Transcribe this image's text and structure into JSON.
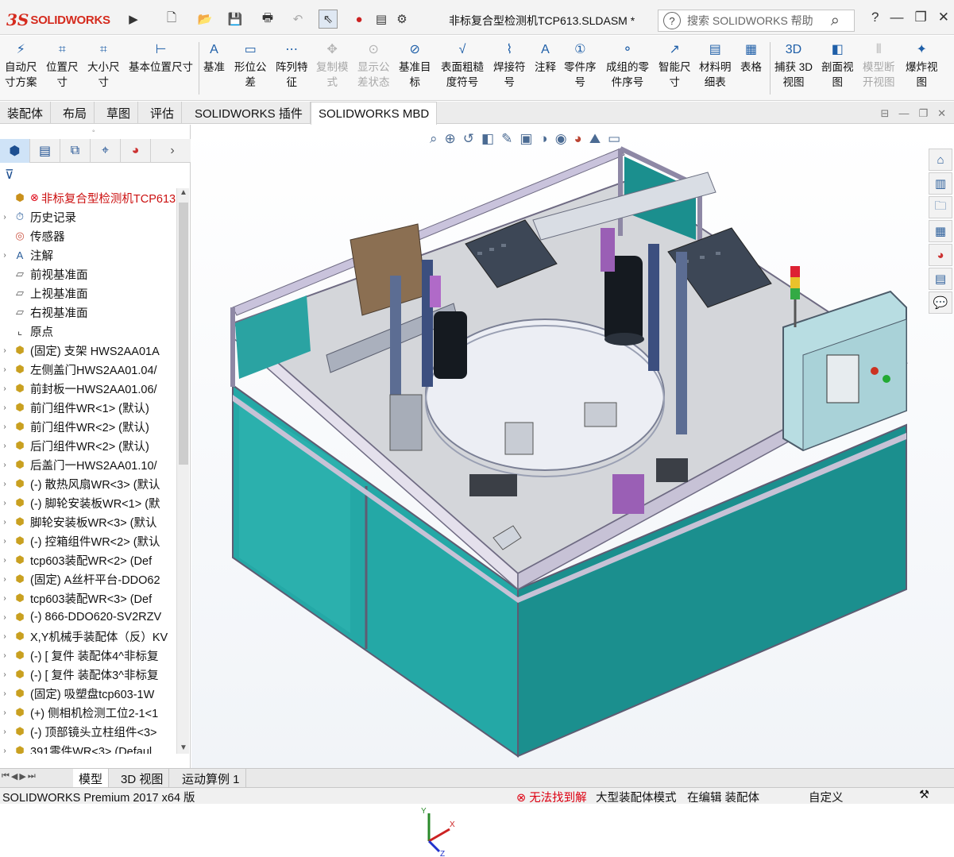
{
  "app": {
    "brand_ds": "3S",
    "brand_name": "SOLIDWORKS",
    "document_title": "非标复合型检测机TCP613.SLDASM *",
    "search_placeholder": "搜索 SOLIDWORKS 帮助",
    "help_label": "?",
    "minimize": "—",
    "close": "✕"
  },
  "commands": [
    {
      "label1": "自动尺",
      "label2": "寸方案",
      "icon": "auto-dimension-icon",
      "enabled": true
    },
    {
      "label1": "位置尺",
      "label2": "寸",
      "icon": "location-dimension-icon",
      "enabled": true
    },
    {
      "label1": "大小尺",
      "label2": "寸",
      "icon": "size-dimension-icon",
      "enabled": true
    },
    {
      "label1": "基本位置尺寸",
      "label2": "",
      "icon": "basic-location-dimension-icon",
      "enabled": true
    },
    {
      "label1": "基准",
      "label2": "",
      "icon": "datum-icon",
      "enabled": true
    },
    {
      "label1": "形位公",
      "label2": "差",
      "icon": "geometric-tolerance-icon",
      "enabled": true
    },
    {
      "label1": "阵列特",
      "label2": "征",
      "icon": "pattern-feature-icon",
      "enabled": true
    },
    {
      "label1": "复制模",
      "label2": "式",
      "icon": "copy-scheme-icon",
      "enabled": false
    },
    {
      "label1": "显示公",
      "label2": "差状态",
      "icon": "tolerance-status-icon",
      "enabled": false
    },
    {
      "label1": "基准目",
      "label2": "标",
      "icon": "datum-target-icon",
      "enabled": true
    },
    {
      "label1": "表面粗糙",
      "label2": "度符号",
      "icon": "surface-finish-icon",
      "enabled": true
    },
    {
      "label1": "焊接符",
      "label2": "号",
      "icon": "weld-symbol-icon",
      "enabled": true
    },
    {
      "label1": "注释",
      "label2": "",
      "icon": "note-icon",
      "enabled": true
    },
    {
      "label1": "零件序",
      "label2": "号",
      "icon": "balloon-icon",
      "enabled": true
    },
    {
      "label1": "成组的零",
      "label2": "件序号",
      "icon": "stacked-balloon-icon",
      "enabled": true
    },
    {
      "label1": "智能尺",
      "label2": "寸",
      "icon": "smart-dimension-icon",
      "enabled": true
    },
    {
      "label1": "材料明",
      "label2": "细表",
      "icon": "bom-icon",
      "enabled": true
    },
    {
      "label1": "表格",
      "label2": "",
      "icon": "table-icon",
      "enabled": true
    },
    {
      "label1": "捕获 3D",
      "label2": "视图",
      "icon": "capture-3d-view-icon",
      "enabled": true
    },
    {
      "label1": "剖面视",
      "label2": "图",
      "icon": "section-view-icon",
      "enabled": true
    },
    {
      "label1": "模型断",
      "label2": "开视图",
      "icon": "model-break-view-icon",
      "enabled": false
    },
    {
      "label1": "爆炸视",
      "label2": "图",
      "icon": "exploded-view-icon",
      "enabled": true
    }
  ],
  "tabs": [
    "装配体",
    "布局",
    "草图",
    "评估",
    "SOLIDWORKS 插件",
    "SOLIDWORKS MBD"
  ],
  "tree": [
    {
      "label": "非标复合型检测机TCP613",
      "type": "root",
      "arrow": ""
    },
    {
      "label": "历史记录",
      "type": "history",
      "arrow": "›"
    },
    {
      "label": "传感器",
      "type": "sensor",
      "arrow": ""
    },
    {
      "label": "注解",
      "type": "annotation",
      "arrow": "›"
    },
    {
      "label": "前视基准面",
      "type": "plane",
      "arrow": ""
    },
    {
      "label": "上视基准面",
      "type": "plane",
      "arrow": ""
    },
    {
      "label": "右视基准面",
      "type": "plane",
      "arrow": ""
    },
    {
      "label": "原点",
      "type": "origin",
      "arrow": ""
    },
    {
      "label": "(固定) 支架 HWS2AA01A",
      "type": "asm",
      "arrow": "›"
    },
    {
      "label": "左侧盖门HWS2AA01.04/",
      "type": "asm",
      "arrow": "›"
    },
    {
      "label": "前封板一HWS2AA01.06/",
      "type": "asm",
      "arrow": "›"
    },
    {
      "label": "前门组件WR<1> (默认)",
      "type": "asm",
      "arrow": "›"
    },
    {
      "label": "前门组件WR<2> (默认)",
      "type": "asm",
      "arrow": "›"
    },
    {
      "label": "后门组件WR<2> (默认)",
      "type": "asm",
      "arrow": "›"
    },
    {
      "label": "后盖门一HWS2AA01.10/",
      "type": "asm",
      "arrow": "›"
    },
    {
      "label": "(-) 散热风扇WR<3> (默认",
      "type": "asm",
      "arrow": "›"
    },
    {
      "label": "(-) 脚轮安装板WR<1> (默",
      "type": "asm",
      "arrow": "›"
    },
    {
      "label": "脚轮安装板WR<3> (默认",
      "type": "asm",
      "arrow": "›"
    },
    {
      "label": "(-) 控箱组件WR<2> (默认",
      "type": "asm",
      "arrow": "›"
    },
    {
      "label": "tcp603装配WR<2> (Def",
      "type": "asm",
      "arrow": "›"
    },
    {
      "label": "(固定) A丝杆平台-DDO62",
      "type": "asm",
      "arrow": "›"
    },
    {
      "label": "tcp603装配WR<3> (Def",
      "type": "asm",
      "arrow": "›"
    },
    {
      "label": "(-) 866-DDO620-SV2RZV",
      "type": "asm",
      "arrow": "›"
    },
    {
      "label": "X,Y机械手装配体（反）KV",
      "type": "asm",
      "arrow": "›"
    },
    {
      "label": "(-) [ 复件 装配体4^非标复",
      "type": "asm",
      "arrow": "›"
    },
    {
      "label": "(-) [ 复件 装配体3^非标复",
      "type": "asm",
      "arrow": "›"
    },
    {
      "label": "(固定) 吸塑盘tcp603-1W",
      "type": "asm",
      "arrow": "›"
    },
    {
      "label": "(+) 侧相机检测工位2-1<1",
      "type": "asm",
      "arrow": "›"
    },
    {
      "label": "(-) 顶部镜头立柱组件<3>",
      "type": "asm",
      "arrow": "›"
    },
    {
      "label": "391零件WR<3> (Defaul",
      "type": "asm",
      "arrow": "›"
    }
  ],
  "bottom_tabs": [
    "模型",
    "3D 视图",
    "运动算例 1"
  ],
  "status": {
    "product": "SOLIDWORKS Premium 2017 x64 版",
    "warning": "无法找到解",
    "mode": "大型装配体模式",
    "editing": "在编辑 装配体",
    "custom": "自定义"
  },
  "colors": {
    "brand_red": "#d52b1e",
    "panel_teal": "#1a8f8c",
    "table_top": "#d4d6da",
    "frame": "#b9b3c8"
  }
}
